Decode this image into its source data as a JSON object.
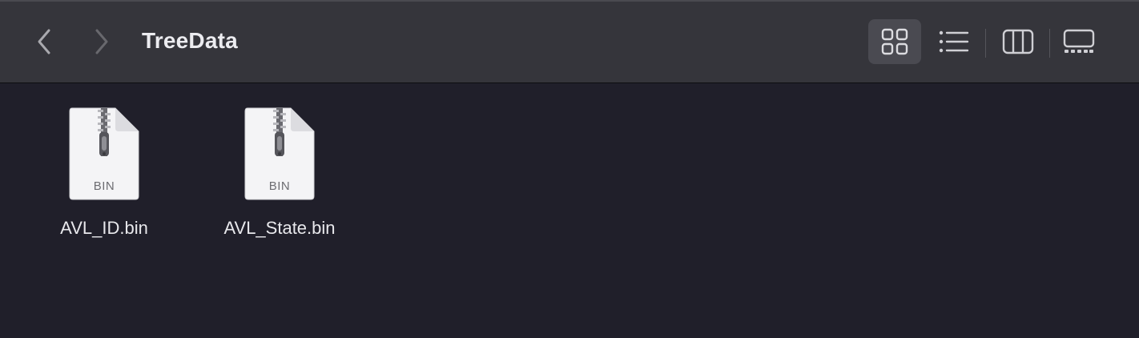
{
  "window": {
    "title": "TreeData"
  },
  "toolbar": {
    "back_icon": "chevron-left-icon",
    "forward_icon": "chevron-right-icon",
    "views": [
      {
        "name": "icons",
        "icon": "grid-icon",
        "active": true
      },
      {
        "name": "list",
        "icon": "list-icon",
        "active": false
      },
      {
        "name": "columns",
        "icon": "columns-icon",
        "active": false
      },
      {
        "name": "gallery",
        "icon": "gallery-icon",
        "active": false
      }
    ]
  },
  "files": [
    {
      "name": "AVL_ID.bin",
      "extension": "BIN",
      "icon": "zip-archive-icon"
    },
    {
      "name": "AVL_State.bin",
      "extension": "BIN",
      "icon": "zip-archive-icon"
    }
  ],
  "colors": {
    "toolbar_bg": "#35353b",
    "content_bg": "#201f2a",
    "active_view_bg": "#4a4a51",
    "text": "#ececf0"
  }
}
